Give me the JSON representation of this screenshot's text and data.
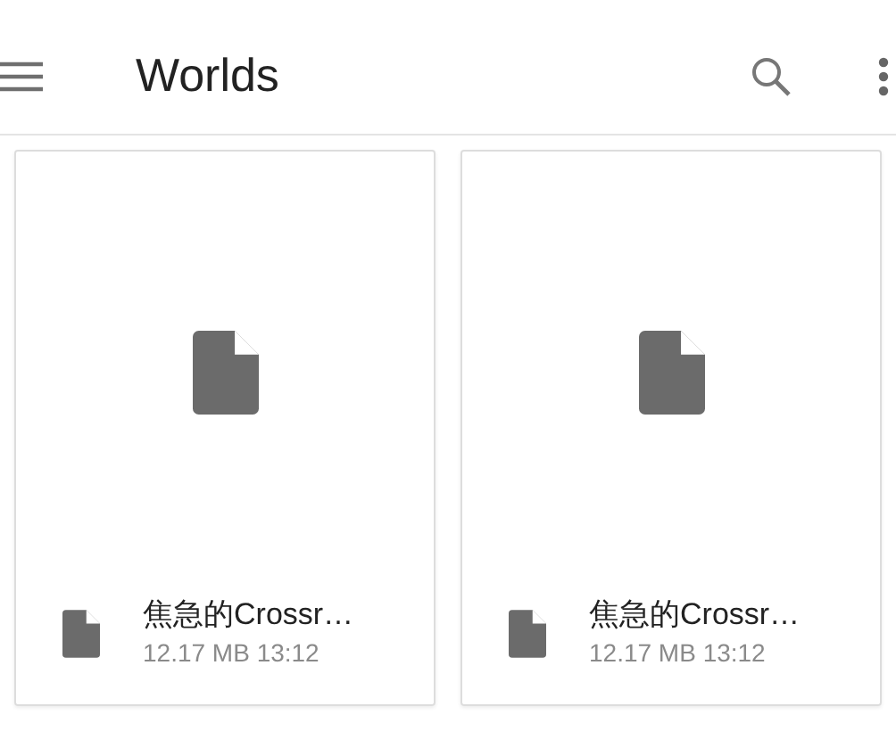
{
  "app_bar": {
    "title": "Worlds"
  },
  "files": [
    {
      "name": "焦急的Crossr…",
      "details": "12.17 MB 13:12"
    },
    {
      "name": "焦急的Crossr…",
      "details": "12.17 MB 13:12"
    }
  ]
}
